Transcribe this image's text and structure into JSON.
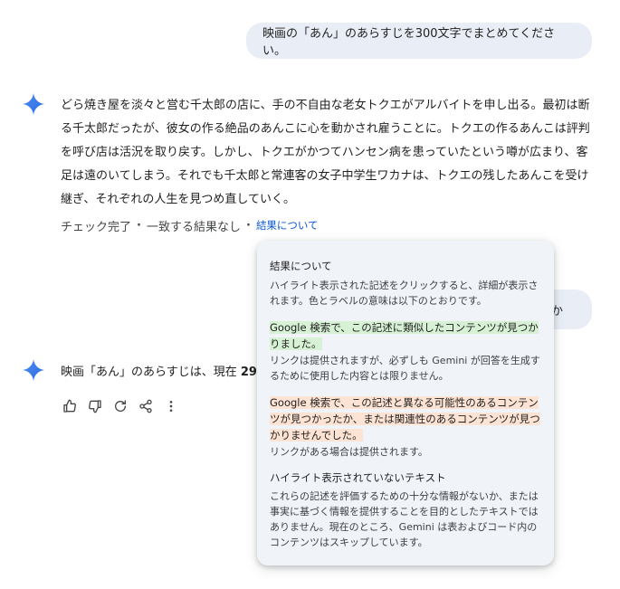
{
  "conversation": {
    "user_message_1": "映画の「あん」のあらすじを300文字でまとめてください。",
    "user_message_2_visible": "すか",
    "response_1": "どら焼き屋を淡々と営む千太郎の店に、手の不自由な老女トクエがアルバイトを申し出る。最初は断る千太郎だったが、彼女の作る絶品のあんこに心を動かされ雇うことに。トクエの作るあんこは評判を呼び店は活況を取り戻す。しかし、トクエがかつてハンセン病を患っていたという噂が広まり、客足は遠のいてしまう。それでも千太郎と常連客の女子中学生ワカナは、トクエの残したあんこを受け継ぎ、それぞれの人生を見つめ直していく。",
    "response_2_prefix": "映画「あん」のあらすじは、現在 ",
    "response_2_bold": "29"
  },
  "double_check": {
    "status": "チェック完了",
    "result": "一致する結果なし",
    "about_link": "結果について"
  },
  "popover": {
    "title": "結果について",
    "description": "ハイライト表示された記述をクリックすると、詳細が表示されます。色とラベルの意味は以下のとおりです。",
    "green_title": "Google 検索で、この記述に類似したコンテンツが見つかりました。",
    "green_desc": "リンクは提供されますが、必ずしも Gemini が回答を生成するために使用した内容とは限りません。",
    "orange_title": "Google 検索で、この記述と異なる可能性のあるコンテンツが見つかったか、または関連性のあるコンテンツが見つかりませんでした。",
    "orange_desc": "リンクがある場合は提供されます。",
    "plain_title": "ハイライト表示されていないテキスト",
    "plain_desc": "これらの記述を評価するための十分な情報がないか、または事実に基づく情報を提供することを目的としたテキストではありません。現在のところ、Gemini は表およびコード内のコンテンツはスキップしています。"
  },
  "icons": {
    "spark": "gemini-spark-icon",
    "actions": [
      "thumbs-up-icon",
      "thumbs-down-icon",
      "regenerate-icon",
      "share-icon",
      "more-vert-icon"
    ]
  },
  "colors": {
    "user_bubble": "#e9eef6",
    "popover_bg": "#f0f4f9",
    "link": "#0b57d0",
    "highlight_green": "#d7f1d5",
    "highlight_orange": "#fde3d3"
  }
}
